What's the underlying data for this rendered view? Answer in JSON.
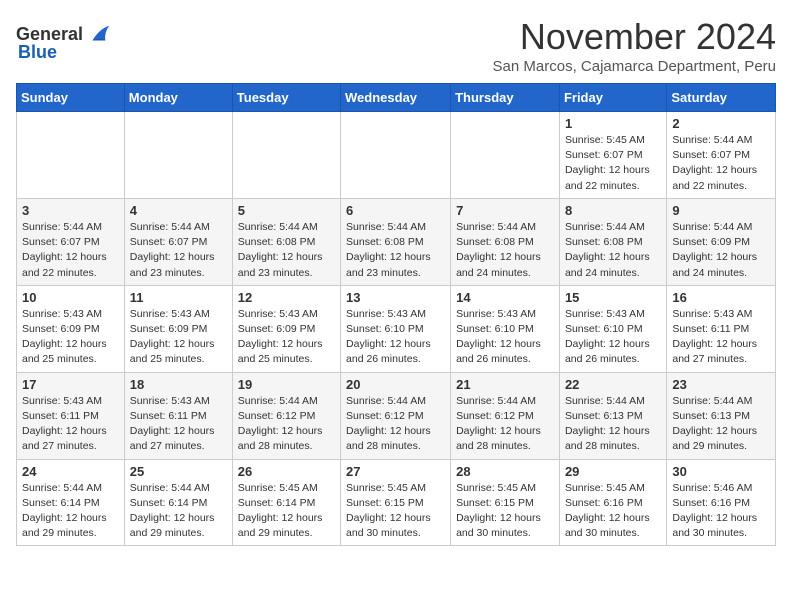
{
  "logo": {
    "text_general": "General",
    "text_blue": "Blue"
  },
  "header": {
    "month_title": "November 2024",
    "subtitle": "San Marcos, Cajamarca Department, Peru"
  },
  "days_of_week": [
    "Sunday",
    "Monday",
    "Tuesday",
    "Wednesday",
    "Thursday",
    "Friday",
    "Saturday"
  ],
  "weeks": [
    [
      {
        "day": "",
        "info": ""
      },
      {
        "day": "",
        "info": ""
      },
      {
        "day": "",
        "info": ""
      },
      {
        "day": "",
        "info": ""
      },
      {
        "day": "",
        "info": ""
      },
      {
        "day": "1",
        "info": "Sunrise: 5:45 AM\nSunset: 6:07 PM\nDaylight: 12 hours and 22 minutes."
      },
      {
        "day": "2",
        "info": "Sunrise: 5:44 AM\nSunset: 6:07 PM\nDaylight: 12 hours and 22 minutes."
      }
    ],
    [
      {
        "day": "3",
        "info": "Sunrise: 5:44 AM\nSunset: 6:07 PM\nDaylight: 12 hours and 22 minutes."
      },
      {
        "day": "4",
        "info": "Sunrise: 5:44 AM\nSunset: 6:07 PM\nDaylight: 12 hours and 23 minutes."
      },
      {
        "day": "5",
        "info": "Sunrise: 5:44 AM\nSunset: 6:08 PM\nDaylight: 12 hours and 23 minutes."
      },
      {
        "day": "6",
        "info": "Sunrise: 5:44 AM\nSunset: 6:08 PM\nDaylight: 12 hours and 23 minutes."
      },
      {
        "day": "7",
        "info": "Sunrise: 5:44 AM\nSunset: 6:08 PM\nDaylight: 12 hours and 24 minutes."
      },
      {
        "day": "8",
        "info": "Sunrise: 5:44 AM\nSunset: 6:08 PM\nDaylight: 12 hours and 24 minutes."
      },
      {
        "day": "9",
        "info": "Sunrise: 5:44 AM\nSunset: 6:09 PM\nDaylight: 12 hours and 24 minutes."
      }
    ],
    [
      {
        "day": "10",
        "info": "Sunrise: 5:43 AM\nSunset: 6:09 PM\nDaylight: 12 hours and 25 minutes."
      },
      {
        "day": "11",
        "info": "Sunrise: 5:43 AM\nSunset: 6:09 PM\nDaylight: 12 hours and 25 minutes."
      },
      {
        "day": "12",
        "info": "Sunrise: 5:43 AM\nSunset: 6:09 PM\nDaylight: 12 hours and 25 minutes."
      },
      {
        "day": "13",
        "info": "Sunrise: 5:43 AM\nSunset: 6:10 PM\nDaylight: 12 hours and 26 minutes."
      },
      {
        "day": "14",
        "info": "Sunrise: 5:43 AM\nSunset: 6:10 PM\nDaylight: 12 hours and 26 minutes."
      },
      {
        "day": "15",
        "info": "Sunrise: 5:43 AM\nSunset: 6:10 PM\nDaylight: 12 hours and 26 minutes."
      },
      {
        "day": "16",
        "info": "Sunrise: 5:43 AM\nSunset: 6:11 PM\nDaylight: 12 hours and 27 minutes."
      }
    ],
    [
      {
        "day": "17",
        "info": "Sunrise: 5:43 AM\nSunset: 6:11 PM\nDaylight: 12 hours and 27 minutes."
      },
      {
        "day": "18",
        "info": "Sunrise: 5:43 AM\nSunset: 6:11 PM\nDaylight: 12 hours and 27 minutes."
      },
      {
        "day": "19",
        "info": "Sunrise: 5:44 AM\nSunset: 6:12 PM\nDaylight: 12 hours and 28 minutes."
      },
      {
        "day": "20",
        "info": "Sunrise: 5:44 AM\nSunset: 6:12 PM\nDaylight: 12 hours and 28 minutes."
      },
      {
        "day": "21",
        "info": "Sunrise: 5:44 AM\nSunset: 6:12 PM\nDaylight: 12 hours and 28 minutes."
      },
      {
        "day": "22",
        "info": "Sunrise: 5:44 AM\nSunset: 6:13 PM\nDaylight: 12 hours and 28 minutes."
      },
      {
        "day": "23",
        "info": "Sunrise: 5:44 AM\nSunset: 6:13 PM\nDaylight: 12 hours and 29 minutes."
      }
    ],
    [
      {
        "day": "24",
        "info": "Sunrise: 5:44 AM\nSunset: 6:14 PM\nDaylight: 12 hours and 29 minutes."
      },
      {
        "day": "25",
        "info": "Sunrise: 5:44 AM\nSunset: 6:14 PM\nDaylight: 12 hours and 29 minutes."
      },
      {
        "day": "26",
        "info": "Sunrise: 5:45 AM\nSunset: 6:14 PM\nDaylight: 12 hours and 29 minutes."
      },
      {
        "day": "27",
        "info": "Sunrise: 5:45 AM\nSunset: 6:15 PM\nDaylight: 12 hours and 30 minutes."
      },
      {
        "day": "28",
        "info": "Sunrise: 5:45 AM\nSunset: 6:15 PM\nDaylight: 12 hours and 30 minutes."
      },
      {
        "day": "29",
        "info": "Sunrise: 5:45 AM\nSunset: 6:16 PM\nDaylight: 12 hours and 30 minutes."
      },
      {
        "day": "30",
        "info": "Sunrise: 5:46 AM\nSunset: 6:16 PM\nDaylight: 12 hours and 30 minutes."
      }
    ]
  ]
}
